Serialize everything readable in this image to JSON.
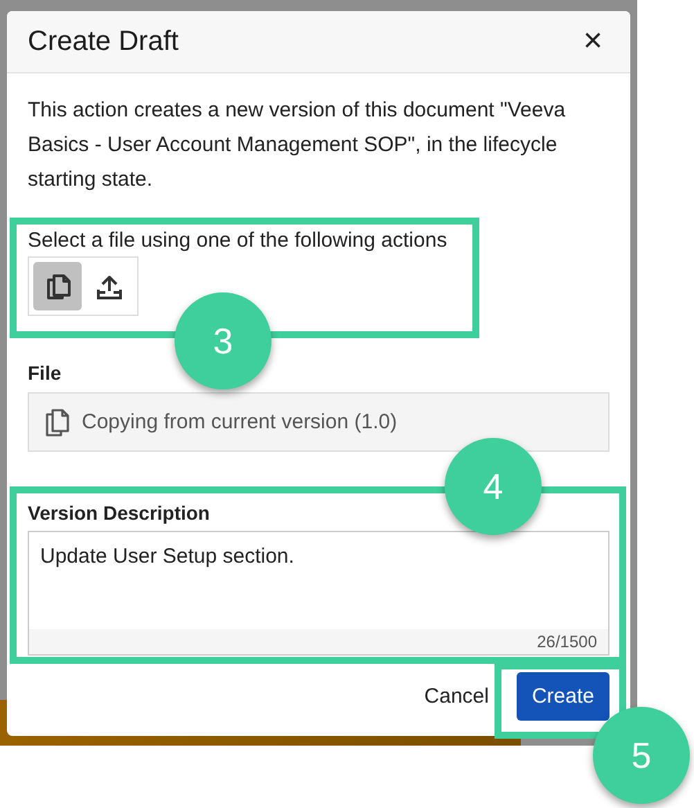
{
  "dialog": {
    "title": "Create Draft",
    "close": "×",
    "message": "This action creates a new version of this document \"Veeva Basics - User Account Management SOP\", in the lifecycle starting state.",
    "file_actions": {
      "label": "Select a file using one of the following actions",
      "buttons": [
        {
          "kind": "copy",
          "selected": true
        },
        {
          "kind": "upload",
          "selected": false
        }
      ]
    },
    "file": {
      "label": "File",
      "value": "Copying from current version (1.0)"
    },
    "version_description": {
      "label": "Version Description",
      "value": "Update User Setup section.",
      "counter": "26/1500"
    },
    "buttons": [
      {
        "kind": "secondary",
        "label": "Cancel"
      },
      {
        "kind": "primary",
        "label": "Create"
      }
    ]
  },
  "annotations": [
    {
      "number": "3"
    },
    {
      "number": "4"
    },
    {
      "number": "5"
    }
  ]
}
